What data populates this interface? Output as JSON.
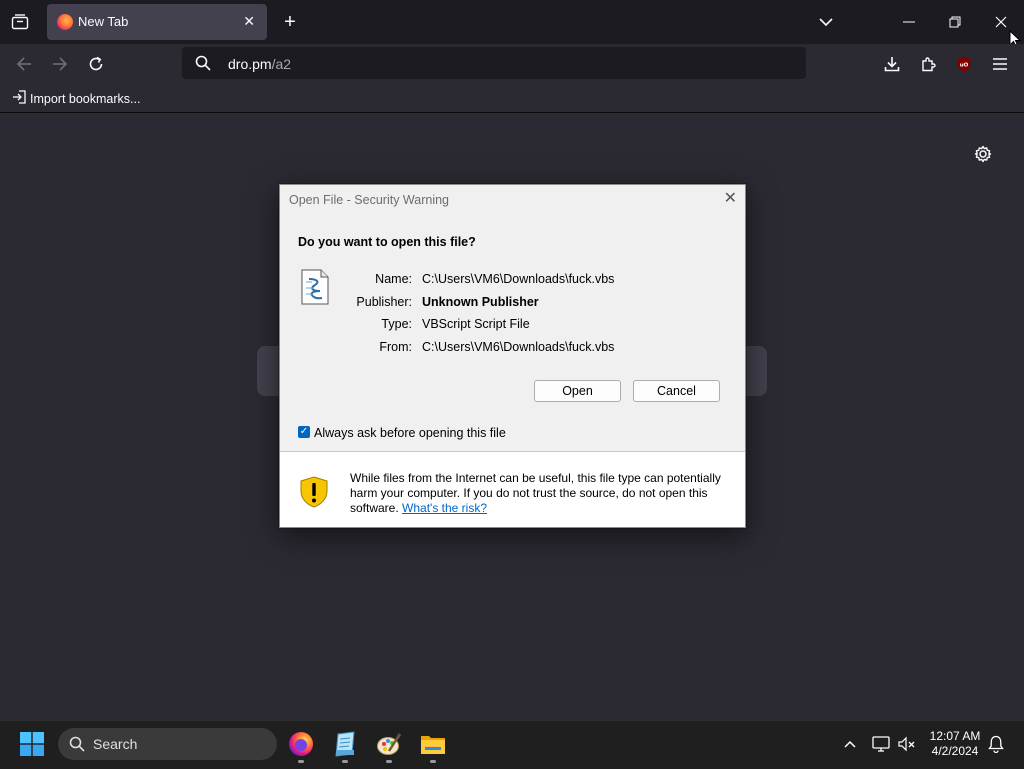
{
  "browser": {
    "tab": {
      "title": "New Tab"
    },
    "address": {
      "host": "dro.pm",
      "path": "/a2"
    },
    "bookmarks": {
      "import_label": "Import bookmarks..."
    }
  },
  "dialog": {
    "title": "Open File - Security Warning",
    "question": "Do you want to open this file?",
    "fields": [
      {
        "label": "Name:",
        "value": "C:\\Users\\VM6\\Downloads\\fuck.vbs"
      },
      {
        "label": "Publisher:",
        "value": "Unknown Publisher"
      },
      {
        "label": "Type:",
        "value": "VBScript Script File"
      },
      {
        "label": "From:",
        "value": "C:\\Users\\VM6\\Downloads\\fuck.vbs"
      }
    ],
    "open_label": "Open",
    "cancel_label": "Cancel",
    "checkbox": {
      "label": "Always ask before opening this file",
      "checked": true
    },
    "warning": {
      "text": "While files from the Internet can be useful, this file type can potentially harm your computer. If you do not trust the source, do not open this software.",
      "link": "What's the risk?"
    }
  },
  "taskbar": {
    "search_label": "Search",
    "clock": {
      "time": "12:07 AM",
      "date": "4/2/2024"
    },
    "apps": [
      "firefox-icon",
      "notepad-icon",
      "paint-icon",
      "file-explorer-icon"
    ]
  },
  "colors": {
    "accent": "#0067c0",
    "browser_bg": "#2b2a33",
    "tabstrip_bg": "#1c1b22",
    "link": "#0066cc"
  }
}
